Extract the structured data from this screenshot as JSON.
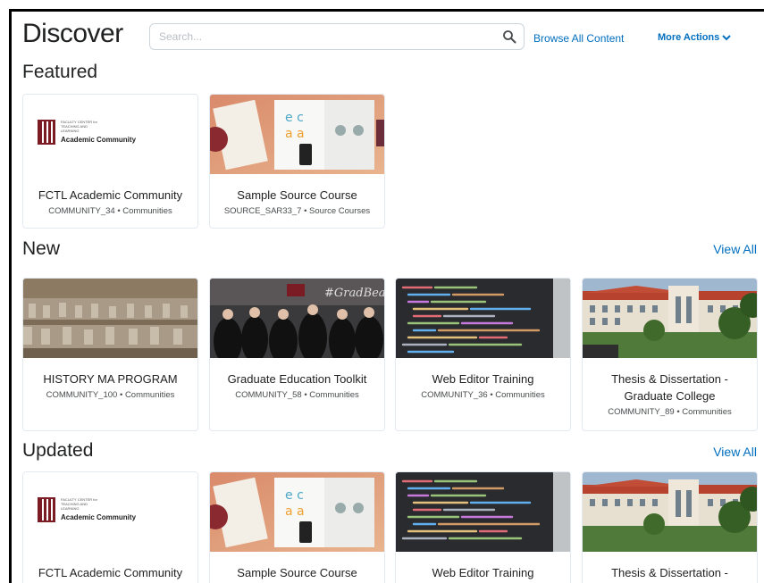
{
  "header": {
    "title": "Discover",
    "search_placeholder": "Search...",
    "browse_label": "Browse All Content",
    "more_label": "More Actions"
  },
  "sections": {
    "featured": {
      "title": "Featured",
      "cards": [
        {
          "title": "FCTL Academic Community",
          "code": "COMMUNITY_34",
          "type": "Communities",
          "thumb": "fctl-logo"
        },
        {
          "title": "Sample Source Course",
          "code": "SOURCE_SAR33_7",
          "type": "Source Courses",
          "thumb": "desk"
        }
      ]
    },
    "new": {
      "title": "New",
      "view_all": "View All",
      "cards": [
        {
          "title": "HISTORY MA PROGRAM",
          "code": "COMMUNITY_100",
          "type": "Communities",
          "thumb": "terracotta"
        },
        {
          "title": "Graduate Education Toolkit",
          "code": "COMMUNITY_58",
          "type": "Communities",
          "thumb": "graduates"
        },
        {
          "title": "Web Editor Training",
          "code": "COMMUNITY_36",
          "type": "Communities",
          "thumb": "code"
        },
        {
          "title": "Thesis & Dissertation - Graduate College",
          "code": "COMMUNITY_89",
          "type": "Communities",
          "thumb": "building"
        }
      ]
    },
    "updated": {
      "title": "Updated",
      "view_all": "View All",
      "cards": [
        {
          "title": "FCTL Academic Community",
          "thumb": "fctl-logo"
        },
        {
          "title": "Sample Source Course",
          "thumb": "desk"
        },
        {
          "title": "Web Editor Training",
          "thumb": "code"
        },
        {
          "title": "Thesis & Dissertation -",
          "thumb": "building"
        }
      ]
    }
  },
  "thumbs": {
    "logo_small_text": "FACULTY CENTER for TEACHING AND LEARNING",
    "logo_main_text": "Academic Community",
    "graduates_text": "#GradBears"
  },
  "colors": {
    "link": "#006fbf",
    "text": "#202122",
    "meta": "#494c4e",
    "card_border": "#e3e9f1",
    "brand_maroon": "#7b1b24"
  }
}
